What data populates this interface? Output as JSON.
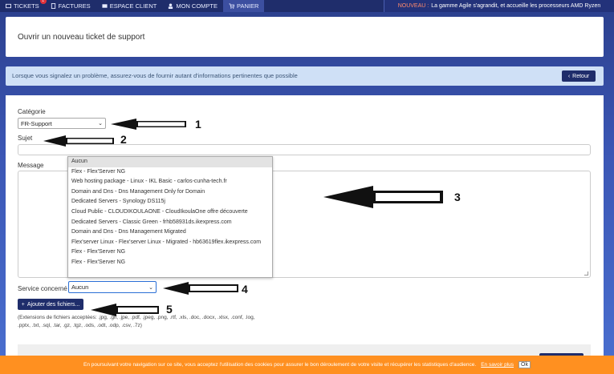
{
  "nav": {
    "items": [
      {
        "label": "TICKETS",
        "icon": "ticket-icon"
      },
      {
        "label": "FACTURES",
        "icon": "invoice-icon"
      },
      {
        "label": "ESPACE CLIENT",
        "icon": "client-space-icon"
      },
      {
        "label": "MON COMPTE",
        "icon": "user-icon"
      },
      {
        "label": "PANIER",
        "icon": "cart-icon"
      }
    ],
    "badge": "1",
    "news_tag": "NOUVEAU :",
    "news_text": "La gamme Agile s'agrandit, et accueille les processeurs AMD Ryzen"
  },
  "header": {
    "title": "Ouvrir un nouveau ticket de support"
  },
  "info": {
    "text": "Lorsque vous signalez un problème, assurez-vous de fournir autant d'informations pertinentes que possible",
    "back_label": "Retour"
  },
  "form": {
    "category_label": "Catégorie",
    "category_value": "FR-Support",
    "subject_label": "Sujet",
    "subject_value": "",
    "message_label": "Message",
    "service_label": "Service concerné",
    "service_value": "Aucun",
    "service_options": [
      "Aucun",
      "Flex - Flex'Server NG",
      "Web hosting package - Linux - IKL Basic - carlos-cunha-tech.fr",
      "Domain and Dns - Dns Management Only for Domain",
      "Dedicated Servers - Synology DS115j",
      "Cloud Public - CLOUDIKOULAONE - CloudIkoulaOne offre découverte",
      "Dedicated Servers - Classic Green - frhb58931ds.ikexpress.com",
      "Domain and Dns - Dns Management Migrated",
      "Flex'server Linux - Flex'server Linux - Migrated - hb63619flex.ikexpress.com",
      "Flex - Flex'Server NG",
      "Flex - Flex'Server NG"
    ],
    "attach_label": "Ajouter des fichiers...",
    "extensions_line1": "(Extensions de fichiers acceptées: .jpg, .gif, .jpe, .pdf, .jpeg, .png, .rtf, .xls, .doc, .docx, .xlsx, .conf, .log,",
    "extensions_line2": ".pptx, .txt, .sql, .tar, .gz, .tgz, .ods, .odt, .odp, .csv, .7z)"
  },
  "cookie": {
    "text": "En poursuivant votre navigation sur ce site, vous acceptez l'utilisation des cookies pour assurer le bon déroulement de votre visite et récupérer les statistiques d'audience.",
    "link": "En savoir plus",
    "ok": "Ok"
  },
  "annotations": [
    "1",
    "2",
    "3",
    "4",
    "5"
  ],
  "colors": {
    "nav": "#1f2d6b",
    "info_bg": "#cfe0f6",
    "cookie_bg": "#ff9020",
    "background": "#3b56b4"
  }
}
